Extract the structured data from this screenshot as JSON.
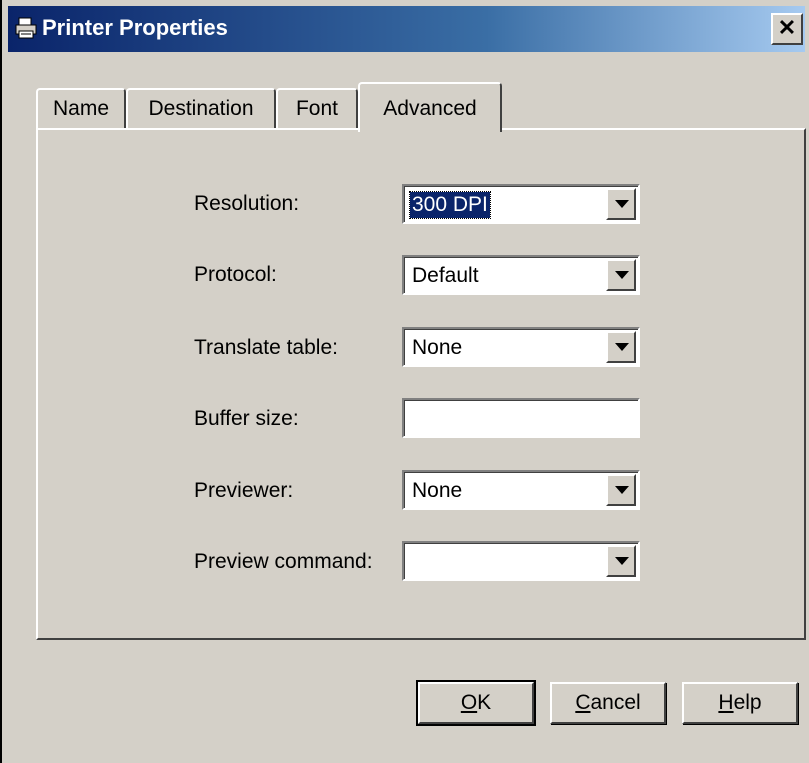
{
  "window": {
    "title": "Printer Properties",
    "title_icon": "printer-icon",
    "close_icon": "close-icon"
  },
  "tabs": [
    {
      "label": "Name"
    },
    {
      "label": "Destination"
    },
    {
      "label": "Font"
    },
    {
      "label": "Advanced",
      "active": true
    }
  ],
  "fields": {
    "resolution": {
      "label": "Resolution:",
      "value": "300 DPI"
    },
    "protocol": {
      "label": "Protocol:",
      "value": "Default"
    },
    "translate_table": {
      "label": "Translate table:",
      "value": "None"
    },
    "buffer_size": {
      "label": "Buffer size:",
      "value": ""
    },
    "previewer": {
      "label": "Previewer:",
      "value": "None"
    },
    "preview_command": {
      "label": "Preview command:",
      "value": ""
    }
  },
  "buttons": {
    "ok": {
      "mnemonic": "O",
      "rest": "K"
    },
    "cancel": {
      "mnemonic": "C",
      "rest": "ancel"
    },
    "help": {
      "mnemonic": "H",
      "rest": "elp"
    }
  },
  "colors": {
    "titlebar_start": "#0a246a",
    "titlebar_end": "#a6caf0",
    "face": "#d4d0c8",
    "selection": "#0a246a"
  }
}
